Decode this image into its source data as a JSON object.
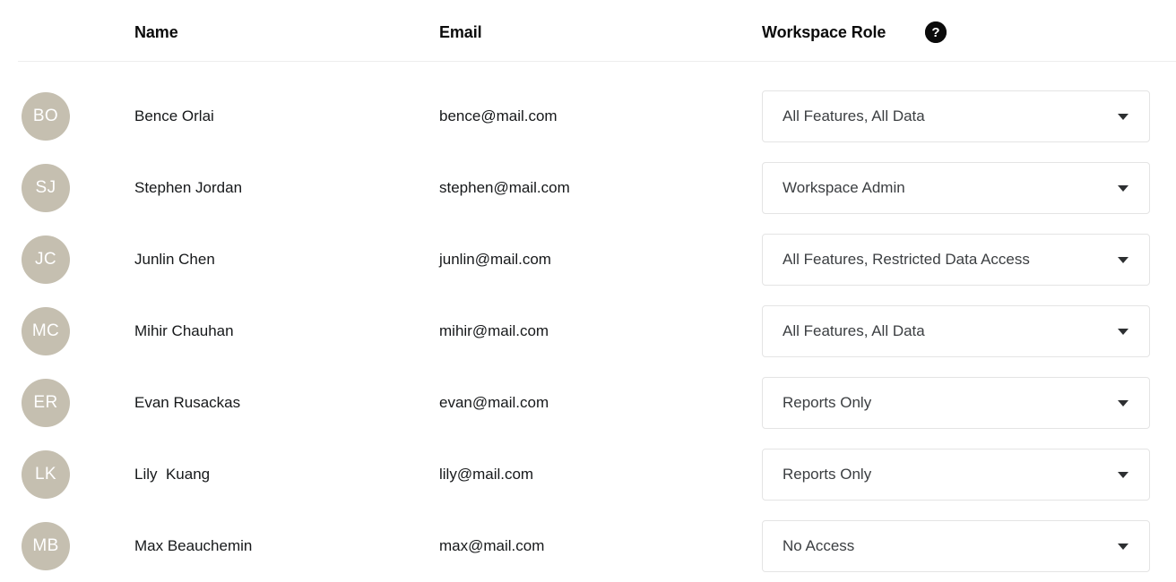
{
  "table": {
    "columns": {
      "name": "Name",
      "email": "Email",
      "role": "Workspace Role"
    },
    "help_icon": {
      "name": "help-circle-icon",
      "glyph": "?"
    },
    "colors": {
      "avatar_background": "#c5bfb0",
      "avatar_text": "#ffffff",
      "divider": "#ededed",
      "select_border": "#e4e4e4",
      "text_primary": "#16181a",
      "select_text": "#3b3e41",
      "help_icon_background": "#0b0b0b"
    },
    "rows": [
      {
        "initials": "BO",
        "name": "Bence Orlai",
        "email": "bence@mail.com",
        "role": "All Features, All Data"
      },
      {
        "initials": "SJ",
        "name": "Stephen Jordan",
        "email": "stephen@mail.com",
        "role": "Workspace Admin"
      },
      {
        "initials": "JC",
        "name": "Junlin Chen",
        "email": "junlin@mail.com",
        "role": "All Features, Restricted Data Access"
      },
      {
        "initials": "MC",
        "name": "Mihir Chauhan",
        "email": "mihir@mail.com",
        "role": "All Features, All Data"
      },
      {
        "initials": "ER",
        "name": "Evan Rusackas",
        "email": "evan@mail.com",
        "role": "Reports Only"
      },
      {
        "initials": "LK",
        "name": "Lily  Kuang",
        "email": "lily@mail.com",
        "role": "Reports Only"
      },
      {
        "initials": "MB",
        "name": "Max Beauchemin",
        "email": "max@mail.com",
        "role": "No Access"
      }
    ]
  }
}
